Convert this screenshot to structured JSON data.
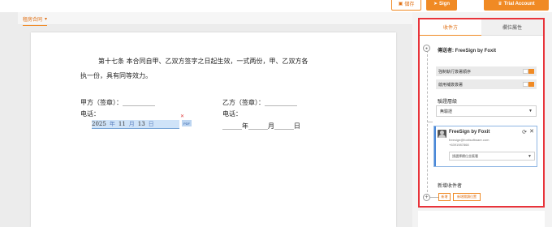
{
  "toolbar": {
    "save_label": "儲存",
    "sign_label": "Sign",
    "trial_label": "Trial Account"
  },
  "doc": {
    "tab_label": "租房合同",
    "paragraph_1": "第十七条  本合同自甲、乙双方签字之日起生效，一式两份，甲、乙双方各",
    "paragraph_2": "执一份，具有同等效力。",
    "party_a_sign": "甲方（签章）：__________",
    "party_b_sign": "乙方（签章）：__________",
    "phone_a": "电话：",
    "phone_b": "电话：",
    "date_b": "______年______月______日",
    "date_field": {
      "year": "2025",
      "year_sep": "年",
      "month": "11",
      "month_sep": "月",
      "day": "13",
      "day_sep": "日"
    },
    "field_badge": "PDF"
  },
  "panel": {
    "tabs": [
      "收件方",
      "欄位屬性"
    ],
    "sender": "傳送者: FreeSign by Foxit",
    "options": [
      "強制執行簽署順序",
      "啟用補簽簽署"
    ],
    "verification_label": "驗證層級",
    "verification_value": "無驗證",
    "recipient": {
      "name": "FreeSign by Foxit",
      "email": "freesign@foxitsoftware.com",
      "phone": "+6391987868",
      "role_placeholder": "請選擇欄位並簽署"
    },
    "add_recipient_label": "新增收件者",
    "add_buttons": [
      "新增",
      "新增閱讀位置"
    ]
  },
  "colors": {
    "accent": "#f08a24",
    "highlight_border": "#e8333a",
    "field_fill": "#cfe3f8"
  }
}
